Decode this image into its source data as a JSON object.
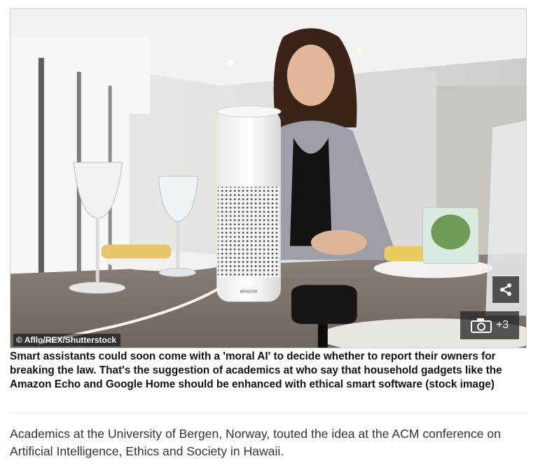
{
  "photo": {
    "credit": "© Afllo/REX/Shutterstock",
    "gallery_count": "+3",
    "share_icon": "share-icon",
    "camera_icon": "camera-icon",
    "device_label": "amazon"
  },
  "caption": "Smart assistants could soon come with a 'moral AI' to decide whether to report their owners for breaking the law. That's the suggestion of academics at who say that household gadgets like the Amazon Echo and Google Home should be enhanced with ethical smart software (stock image)",
  "body_paragraph": "Academics at the University of Bergen, Norway, touted the idea at the ACM conference on Artificial Intelligence, Ethics and Society in Hawaii."
}
